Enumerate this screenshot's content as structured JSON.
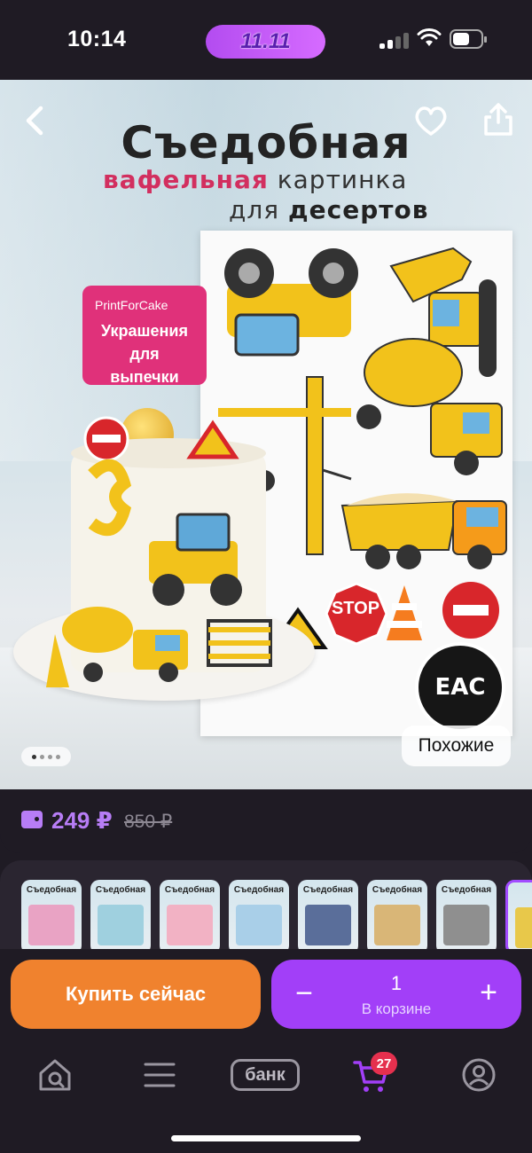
{
  "status_bar": {
    "time": "10:14",
    "promo": "11.11",
    "battery_level": 0.6
  },
  "hero": {
    "title": "Съедобная",
    "subtitle_accent": "вафельная",
    "subtitle_rest": "картинка",
    "subtitle2_prefix": "для",
    "subtitle2_bold": "десертов",
    "brand_name": "PrintForCake",
    "brand_text_l1": "Украшения",
    "brand_text_l2": "для",
    "brand_text_l3": "выпечки",
    "stop_sign": "STOP",
    "cert_text": "EAC",
    "similar_label": "Похожие",
    "carousel_count": 4,
    "carousel_active": 1
  },
  "price": {
    "current": "249 ₽",
    "old": "850 ₽"
  },
  "thumbnails": [
    {
      "title": "Съедобная",
      "color": "#e9a3c4",
      "selected": false
    },
    {
      "title": "Съедобная",
      "color": "#9fd0df",
      "selected": false
    },
    {
      "title": "Съедобная",
      "color": "#f2b2c4",
      "selected": false
    },
    {
      "title": "Съедобная",
      "color": "#a9cfe8",
      "selected": false
    },
    {
      "title": "Съедобная",
      "color": "#5a6e9a",
      "selected": false
    },
    {
      "title": "Съедобная",
      "color": "#d9b677",
      "selected": false
    },
    {
      "title": "Съедобная",
      "color": "#8f8f8f",
      "selected": false
    },
    {
      "title": "",
      "color": "#e8c84a",
      "selected": true
    }
  ],
  "actions": {
    "buy_label": "Купить сейчас",
    "quantity": "1",
    "in_cart_label": "В корзине",
    "minus": "−",
    "plus": "+"
  },
  "nav": {
    "bank_label": "банк",
    "cart_badge": "27",
    "items": [
      "home-search-icon",
      "menu-icon",
      "bank",
      "cart-icon",
      "profile-icon"
    ]
  },
  "colors": {
    "accent_purple": "#a23ff8",
    "price_purple": "#b77df6",
    "buy_orange": "#f0822e",
    "badge_red": "#e5304e"
  }
}
